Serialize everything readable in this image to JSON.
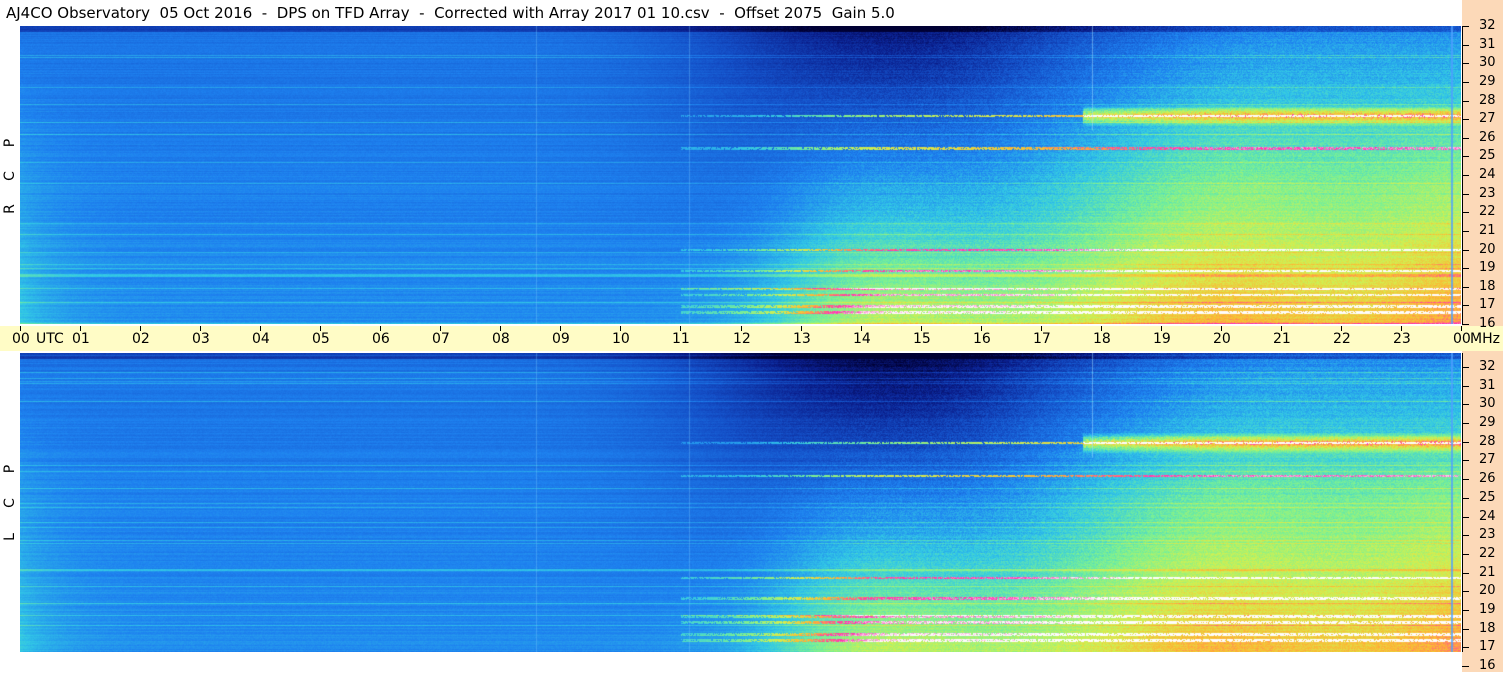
{
  "title": "AJ4CO Observatory  05 Oct 2016  -  DPS on TFD Array  -  Corrected with Array 2017 01 10.csv  -  Offset 2075  Gain 5.0",
  "panels": [
    {
      "id": "rcp",
      "letters": [
        "R",
        "C",
        "P"
      ]
    },
    {
      "id": "lcp",
      "letters": [
        "L",
        "C",
        "P"
      ]
    }
  ],
  "time_axis": {
    "labels": [
      "00",
      "01",
      "02",
      "03",
      "04",
      "05",
      "06",
      "07",
      "08",
      "09",
      "10",
      "11",
      "12",
      "13",
      "14",
      "15",
      "16",
      "17",
      "18",
      "19",
      "20",
      "21",
      "22",
      "23",
      "00"
    ],
    "unit_left": "UTC",
    "unit_right": "MHz"
  },
  "colors": {
    "background_right": "#fcd9b8",
    "time_axis_bg": "#fffcc6",
    "colormap": [
      "#000033",
      "#0a1e8c",
      "#1450c8",
      "#1e82f0",
      "#32c8e6",
      "#78f096",
      "#d2f050",
      "#ffb432",
      "#ff32b4",
      "#ffffff"
    ]
  },
  "chart_data": [
    {
      "type": "heatmap",
      "title": "R C P",
      "x": {
        "unit": "UTC hours",
        "range": [
          0,
          24
        ],
        "ticks": [
          "00",
          "01",
          "02",
          "03",
          "04",
          "05",
          "06",
          "07",
          "08",
          "09",
          "10",
          "11",
          "12",
          "13",
          "14",
          "15",
          "16",
          "17",
          "18",
          "19",
          "20",
          "21",
          "22",
          "23",
          "00"
        ]
      },
      "y": {
        "unit": "MHz",
        "range": [
          16,
          32
        ],
        "ticks": [
          16,
          17,
          18,
          19,
          20,
          21,
          22,
          23,
          24,
          25,
          26,
          27,
          28,
          29,
          30,
          31,
          32
        ]
      },
      "description_features": {
        "dark_band_hours": [
          10,
          18
        ],
        "bright_band_MHz": [
          26,
          28
        ],
        "bright_hours": [
          18,
          24
        ]
      }
    },
    {
      "type": "heatmap",
      "title": "L C P",
      "x": {
        "unit": "UTC hours",
        "range": [
          0,
          24
        ]
      },
      "y": {
        "unit": "MHz",
        "range": [
          16,
          32
        ],
        "ticks": [
          16,
          17,
          18,
          19,
          20,
          21,
          22,
          23,
          24,
          25,
          26,
          27,
          28,
          29,
          30,
          31,
          32
        ]
      }
    }
  ]
}
